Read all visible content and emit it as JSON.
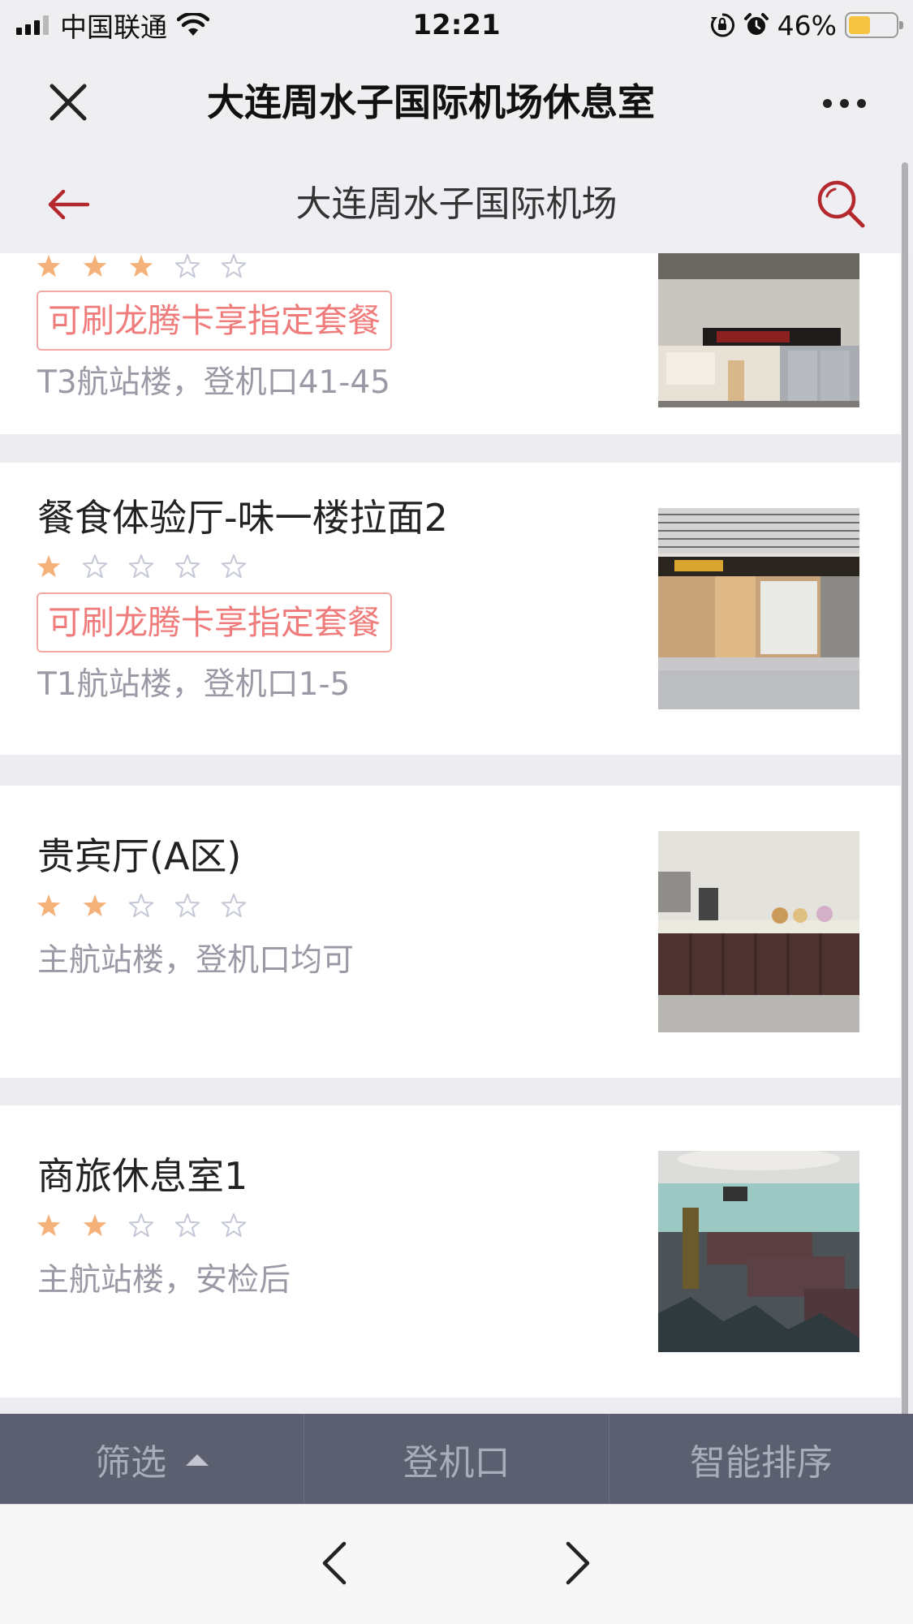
{
  "status_bar": {
    "carrier": "中国联通",
    "time": "12:21",
    "battery_percent": "46%",
    "battery_level": 0.46,
    "icons": [
      "signal-icon",
      "wifi-icon",
      "orientation-lock-icon",
      "alarm-icon",
      "battery-icon"
    ]
  },
  "wechat_bar": {
    "title": "大连周水子国际机场休息室",
    "close_icon": "close-icon",
    "more_icon": "more-icon"
  },
  "header": {
    "title": "大连周水子国际机场",
    "back_icon": "back-arrow-icon",
    "search_icon": "search-icon"
  },
  "colors": {
    "accent": "#b3292e",
    "tag_text": "#ef7b7b",
    "tag_border": "#f2a7a7",
    "star_filled": "#f4b27a",
    "star_empty": "#c5c8d6",
    "filter_bar": "#5b5f6f",
    "filter_text": "#a9adbb"
  },
  "lounges": [
    {
      "name": "",
      "rating": 3,
      "max_rating": 5,
      "tag": "可刷龙腾卡享指定套餐",
      "location": "T3航站楼，登机口41-45",
      "image": "noodle-shop-photo"
    },
    {
      "name": "餐食体验厅-味一楼拉面2",
      "rating": 1,
      "max_rating": 5,
      "tag": "可刷龙腾卡享指定套餐",
      "location": "T1航站楼，登机口1-5",
      "image": "ramen-shop-photo"
    },
    {
      "name": "贵宾厅(A区)",
      "rating": 2,
      "max_rating": 5,
      "tag": "",
      "location": "主航站楼，登机口均可",
      "image": "vip-buffet-photo"
    },
    {
      "name": "商旅休息室1",
      "rating": 2,
      "max_rating": 5,
      "tag": "",
      "location": "主航站楼，安检后",
      "image": "business-lounge-photo"
    }
  ],
  "filter_bar": {
    "filter_label": "筛选",
    "gate_label": "登机口",
    "sort_label": "智能排序"
  },
  "bottom_nav": {
    "prev_icon": "chevron-left-icon",
    "next_icon": "chevron-right-icon"
  }
}
